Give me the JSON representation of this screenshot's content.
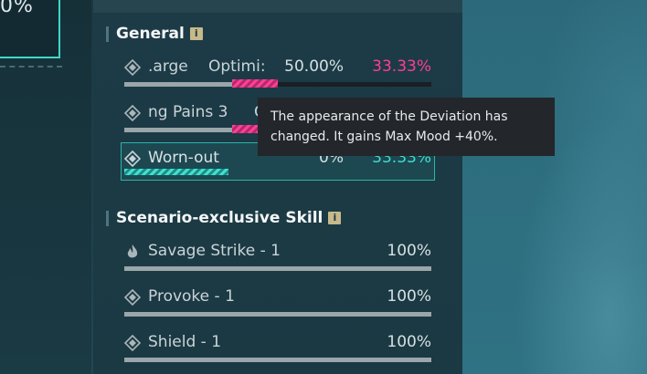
{
  "left": {
    "value": "0%"
  },
  "general": {
    "title": "General",
    "rows": [
      {
        "name": ".arge",
        "mid": "Optimi:",
        "value": "50.00%",
        "value2": "33.33%"
      },
      {
        "name": "ng Pains 3",
        "mid": "C",
        "value": "",
        "value2": ""
      },
      {
        "name": "Worn-out",
        "mid": "",
        "value": "0%",
        "value2": "33.33%"
      }
    ]
  },
  "tooltip": {
    "text": "The appearance of the Deviation has changed. It gains Max Mood +40%."
  },
  "scenario": {
    "title": "Scenario-exclusive Skill",
    "rows": [
      {
        "name": "Savage Strike - 1",
        "value": "100%",
        "icon": "flame-icon"
      },
      {
        "name": "Provoke - 1",
        "value": "100%",
        "icon": "diamond-icon"
      },
      {
        "name": "Shield - 1",
        "value": "100%",
        "icon": "diamond-icon"
      }
    ]
  },
  "colors": {
    "accent_pink": "#ff3e94",
    "accent_cyan": "#3fe0d0"
  }
}
